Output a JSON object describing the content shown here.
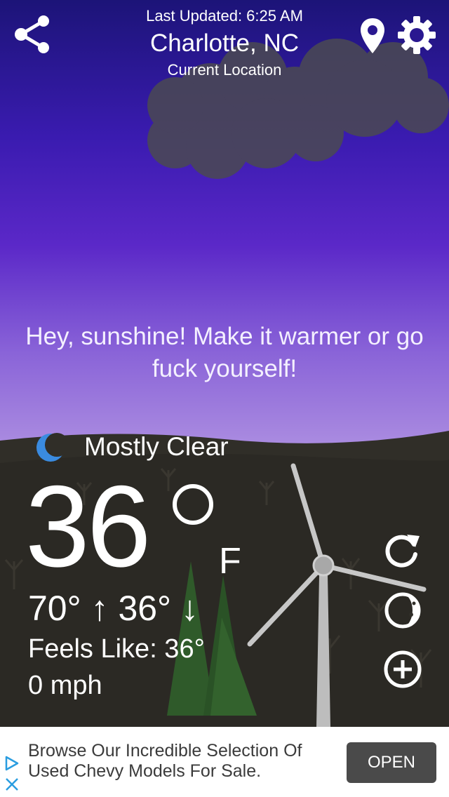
{
  "header": {
    "last_updated": "Last Updated: 6:25 AM",
    "city": "Charlotte, NC",
    "location_label": "Current Location"
  },
  "message": "Hey, sunshine! Make it warmer or go fuck yourself!",
  "current": {
    "condition": "Mostly Clear",
    "condition_icon": "crescent-moon-icon",
    "temperature": "36",
    "unit": "F",
    "high": "70°",
    "low": "36°",
    "feels_like": "Feels Like: 36°",
    "wind": "0 mph"
  },
  "actions": {
    "left": "share-icon",
    "right": [
      "map-pin-icon",
      "gear-icon"
    ],
    "side": [
      "refresh-icon",
      "moon-phase-icon",
      "add-icon"
    ]
  },
  "ad": {
    "text": "Browse Our Incredible Selection Of Used Chevy Models For Sale.",
    "button_label": "OPEN"
  },
  "colors": {
    "sky_top": "#1c1478",
    "sky_bottom": "#b59bdf",
    "ground": "#302e28",
    "moon": "#3a8be0",
    "ad_button": "#4a4a4a"
  }
}
